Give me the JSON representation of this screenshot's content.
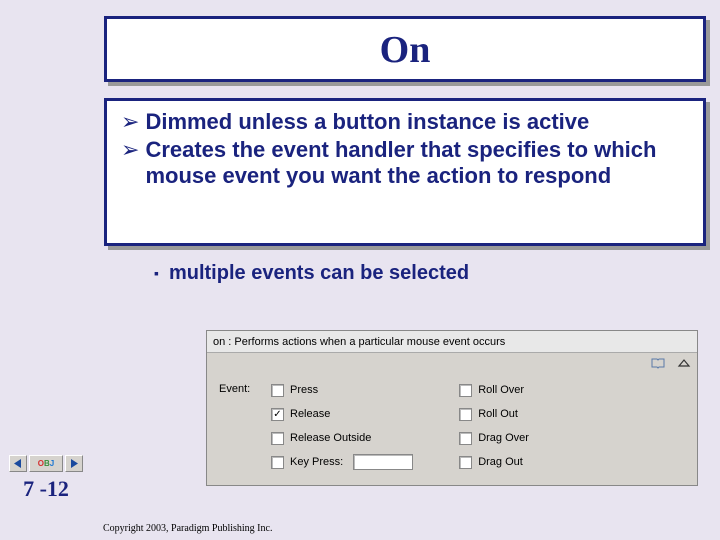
{
  "title": "On",
  "bullets": [
    "Dimmed unless a button instance is active",
    "Creates the event handler that specifies to which mouse event you want the action to respond"
  ],
  "sub_bullet": "multiple events can be selected",
  "panel": {
    "header": "on : Performs actions when a particular mouse event occurs",
    "event_label": "Event:",
    "col1": {
      "press": "Press",
      "release": "Release",
      "release_outside": "Release Outside",
      "key_press": "Key Press:"
    },
    "col2": {
      "roll_over": "Roll Over",
      "roll_out": "Roll Out",
      "drag_over": "Drag Over",
      "drag_out": "Drag Out"
    },
    "release_checked": "✓"
  },
  "nav": {
    "obj": "OBJ",
    "page": "7 -12"
  },
  "copyright": "Copyright 2003, Paradigm Publishing Inc."
}
